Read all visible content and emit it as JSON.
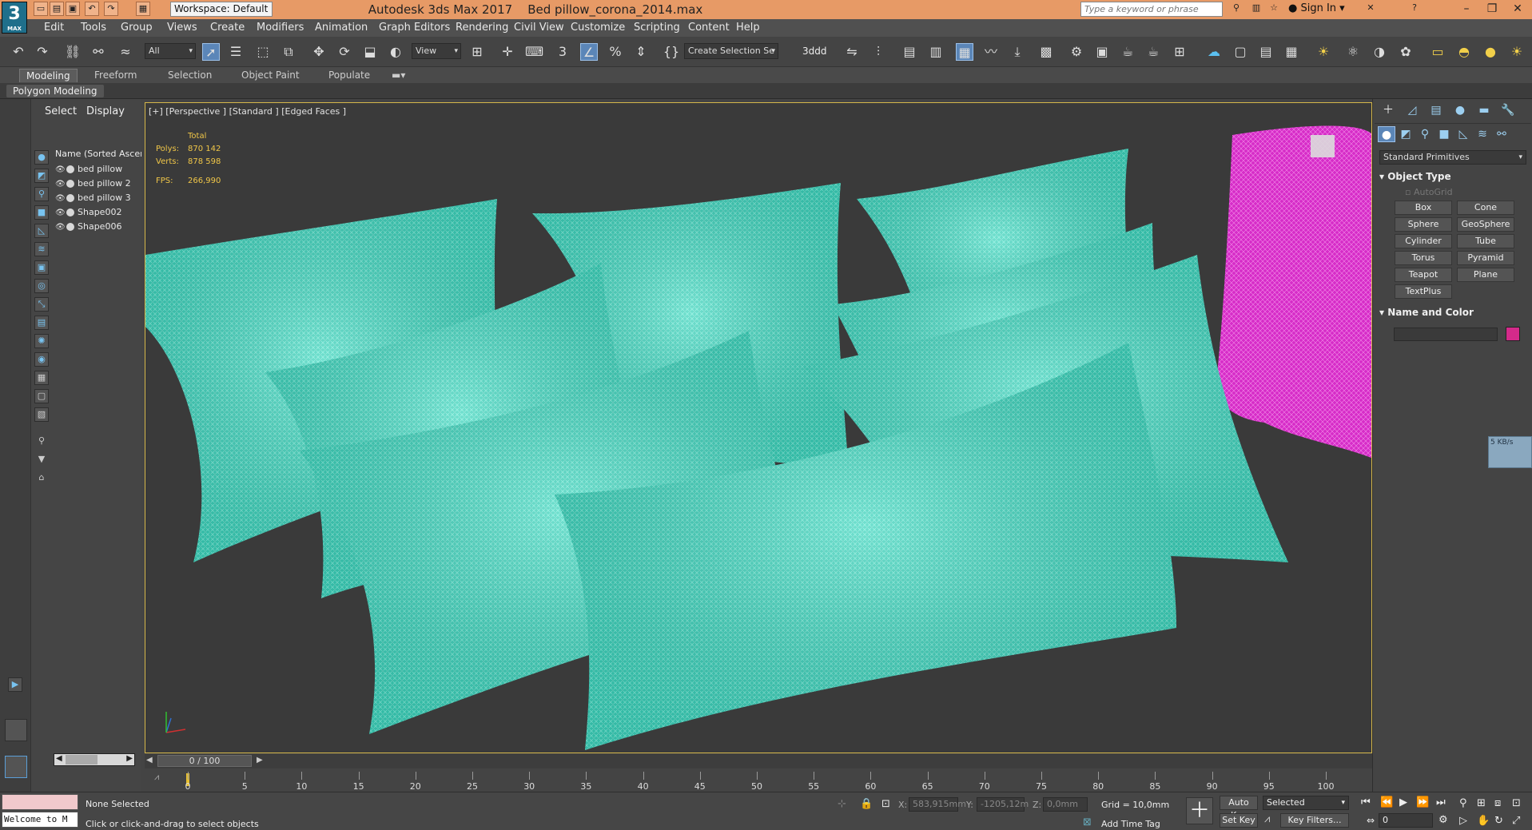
{
  "window": {
    "app_title": "Autodesk 3ds Max 2017",
    "file_name": "Bed pillow_corona_2014.max",
    "workspace": "Workspace: Default",
    "search_placeholder": "Type a keyword or phrase",
    "sign_in": "Sign In",
    "logo_text": "3",
    "logo_sub": "MAX"
  },
  "menu": [
    "Edit",
    "Tools",
    "Group",
    "Views",
    "Create",
    "Modifiers",
    "Animation",
    "Graph Editors",
    "Rendering",
    "Civil View",
    "Customize",
    "Scripting",
    "Content",
    "Help"
  ],
  "toolbar": {
    "filter": "All",
    "ref_coord": "View",
    "selection_set": "Create Selection Se",
    "label_3ddd": "3ddd"
  },
  "ribbon": {
    "tabs": [
      "Modeling",
      "Freeform",
      "Selection",
      "Object Paint",
      "Populate"
    ],
    "active_tab": "Modeling",
    "panel_label": "Polygon Modeling"
  },
  "scene_explorer": {
    "tabs": [
      "Select",
      "Display"
    ],
    "column_header": "Name (Sorted Ascend",
    "objects": [
      "bed pillow",
      "bed pillow 2",
      "bed pillow 3",
      "Shape002",
      "Shape006"
    ]
  },
  "viewport": {
    "label": "[+] [Perspective ] [Standard ] [Edged Faces ]",
    "stats": {
      "total_label": "Total",
      "polys_label": "Polys:",
      "polys": "870 142",
      "verts_label": "Verts:",
      "verts": "878 598",
      "fps_label": "FPS:",
      "fps": "266,990"
    },
    "colors": {
      "pillow_wire": "#46e8cf",
      "pink_object": "#e23ad2",
      "background": "#3a3a3a"
    }
  },
  "command_panel": {
    "category": "Standard Primitives",
    "object_type_title": "Object Type",
    "autogrid": "AutoGrid",
    "primitives": [
      "Box",
      "Cone",
      "Sphere",
      "GeoSphere",
      "Cylinder",
      "Tube",
      "Torus",
      "Pyramid",
      "Teapot",
      "Plane",
      "TextPlus"
    ],
    "name_color_title": "Name and Color",
    "color_swatch": "#d42a8a",
    "net_badge": "5 KB/s"
  },
  "timeline": {
    "frame_display": "0 / 100",
    "ticks": [
      "0",
      "5",
      "10",
      "15",
      "20",
      "25",
      "30",
      "35",
      "40",
      "45",
      "50",
      "55",
      "60",
      "65",
      "70",
      "75",
      "80",
      "85",
      "90",
      "95",
      "100"
    ]
  },
  "status": {
    "maxscript": "Welcome to M",
    "selection": "None Selected",
    "prompt": "Click or click-and-drag to select objects",
    "x_label": "X:",
    "x_value": "583,915mm",
    "y_label": "Y:",
    "y_value": "-1205,12m",
    "z_label": "Z:",
    "z_value": "0,0mm",
    "grid": "Grid = 10,0mm",
    "add_time_tag": "Add Time Tag",
    "auto_key": "Auto Key",
    "set_key": "Set Key",
    "key_mode": "Selected",
    "key_filters": "Key Filters...",
    "frame": "0"
  }
}
